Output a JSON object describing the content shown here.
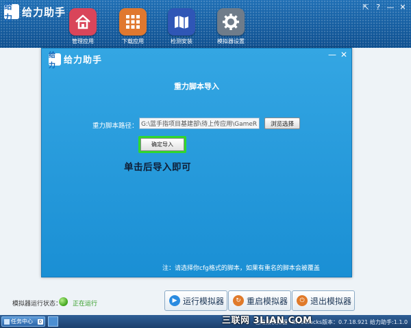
{
  "app": {
    "title": "给力助手",
    "logo_mark": "给力",
    "window_controls": [
      "pin-icon",
      "help-icon",
      "minimize-icon",
      "close-icon"
    ]
  },
  "nav": {
    "items": [
      {
        "label": "管理应用",
        "icon": "home-icon",
        "color": "#d9455a"
      },
      {
        "label": "下载应用",
        "icon": "grid-icon",
        "color": "#e0782f"
      },
      {
        "label": "检测安装",
        "icon": "map-icon",
        "color": "#2f56b6"
      },
      {
        "label": "模拟器设置",
        "icon": "gear-icon",
        "color": "#6f7c8a"
      }
    ]
  },
  "dialog": {
    "title": "重力脚本导入",
    "path_label": "重力脚本路径：",
    "path_value": "G:\\蓝手指项目基建部\\待上传应用\\GameRPG\\",
    "browse_label": "浏览选择",
    "confirm_label": "确定导入",
    "hint": "单击后导入即可",
    "note": "注：请选择你cfg格式的脚本，如果有重名的脚本会被覆盖"
  },
  "status": {
    "label": "模拟器运行状态：",
    "value": "正在运行",
    "indicator_color": "#3fa31b"
  },
  "actions": [
    {
      "label": "运行模拟器",
      "icon": "play-icon",
      "color": "#2a8be0"
    },
    {
      "label": "重启模拟器",
      "icon": "restart-icon",
      "color": "#e07a2a"
    },
    {
      "label": "退出模拟器",
      "icon": "power-icon",
      "color": "#e07a2a"
    }
  ],
  "taskbar": {
    "start_label": "任务中心",
    "start_count": "0",
    "connected": "已连接模拟器",
    "bluestacks_version": "BlueStacks版本：0.7.18.921",
    "app_version": "给力助手:1.1.0"
  },
  "watermark": "三联网 3LIAN.COM"
}
